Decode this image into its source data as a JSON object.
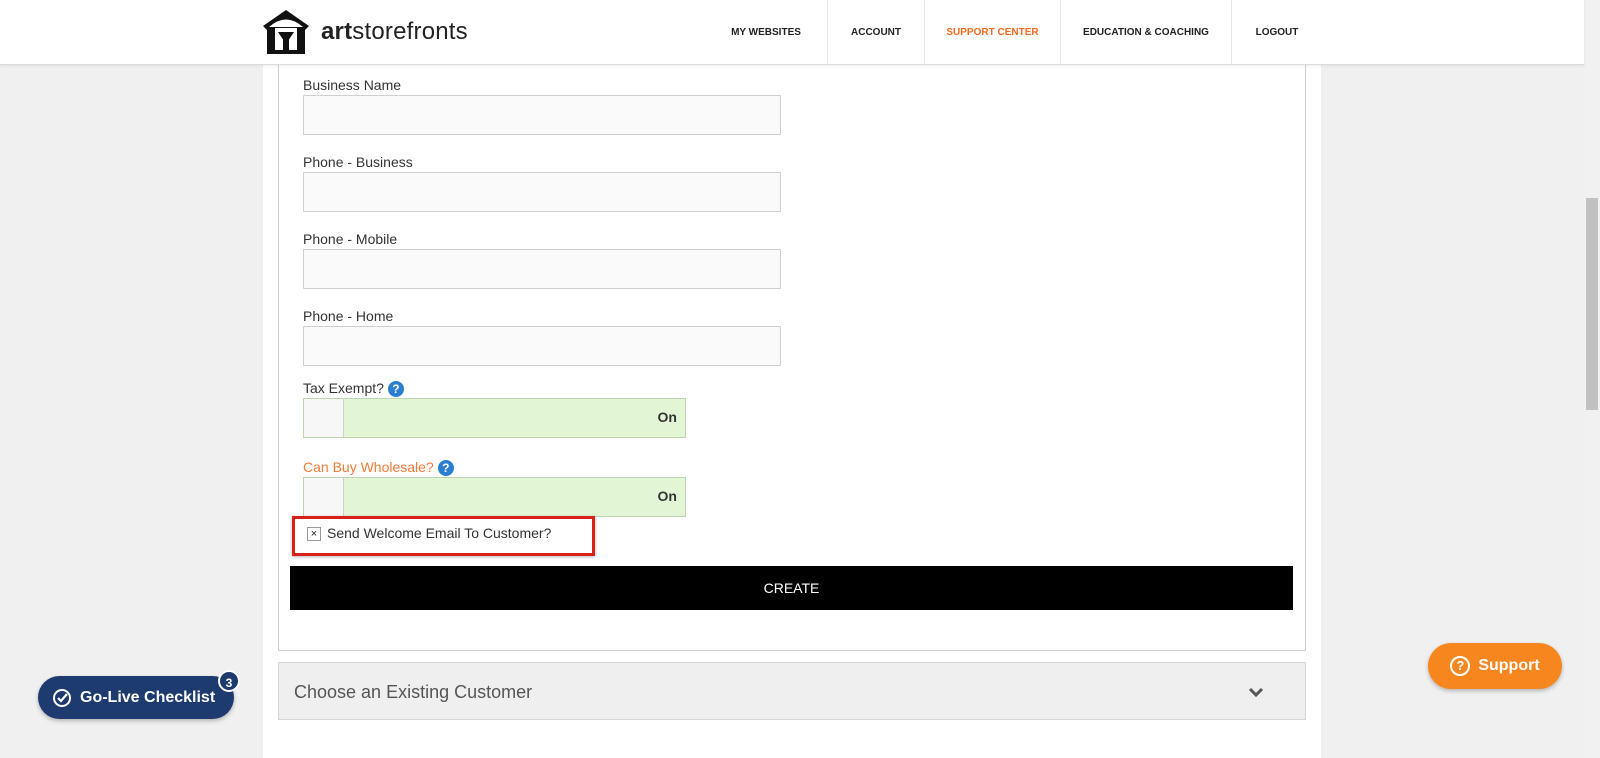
{
  "header": {
    "logo_bold": "art",
    "logo_light": "storefronts",
    "nav": [
      {
        "label": "MY WEBSITES"
      },
      {
        "label": "ACCOUNT"
      },
      {
        "label": "SUPPORT CENTER"
      },
      {
        "label": "EDUCATION & COACHING"
      },
      {
        "label": "LOGOUT"
      }
    ]
  },
  "form": {
    "business_name_label": "Business Name",
    "phone_business_label": "Phone - Business",
    "phone_mobile_label": "Phone - Mobile",
    "phone_home_label": "Phone - Home",
    "tax_exempt_label": "Tax Exempt?",
    "tax_exempt_value": "On",
    "wholesale_label": "Can Buy Wholesale?",
    "wholesale_value": "On",
    "welcome_email_label": "Send Welcome Email To Customer?",
    "welcome_email_checked": "×",
    "create_label": "CREATE"
  },
  "existing": {
    "label": "Choose an Existing Customer"
  },
  "golive": {
    "label": "Go-Live Checklist",
    "badge": "3"
  },
  "support": {
    "label": "Support"
  },
  "colors": {
    "accent": "#f26b21",
    "navy": "#1d3b6e",
    "support": "#f7861f"
  }
}
